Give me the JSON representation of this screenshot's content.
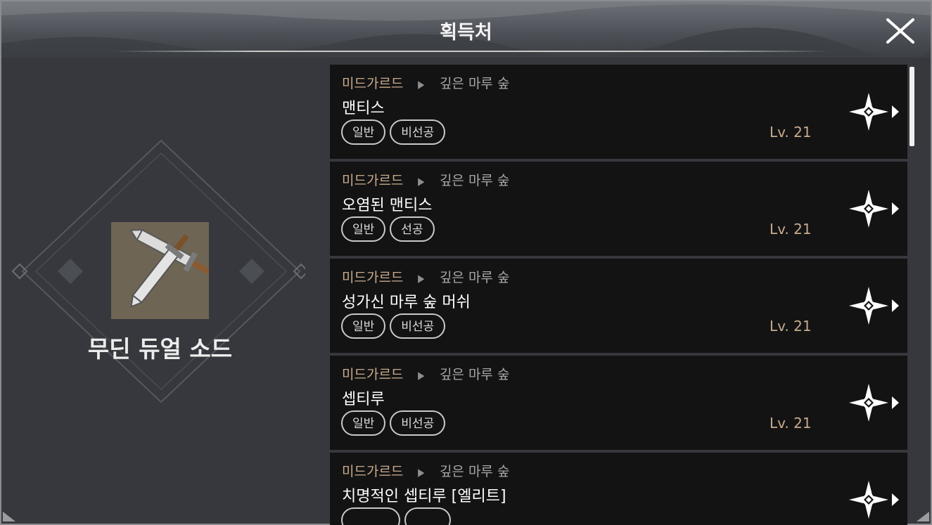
{
  "dialog": {
    "title": "획득처",
    "close_icon": "close-x-icon"
  },
  "item": {
    "name": "무딘 듀얼 소드",
    "icon": "dual-sword-icon",
    "icon_bg": "#6f6555"
  },
  "colors": {
    "region": "#c8ab8b",
    "level": "#c8ab8b",
    "zone": "#a6a6a6"
  },
  "sources": [
    {
      "region": "미드가르드",
      "zone": "깊은 마루 숲",
      "monster": "맨티스",
      "tags": [
        "일반",
        "비선공"
      ],
      "level": "Lv. 21"
    },
    {
      "region": "미드가르드",
      "zone": "깊은 마루 숲",
      "monster": "오염된 맨티스",
      "tags": [
        "일반",
        "선공"
      ],
      "level": "Lv. 21"
    },
    {
      "region": "미드가르드",
      "zone": "깊은 마루 숲",
      "monster": "성가신 마루 숲 머쉬",
      "tags": [
        "일반",
        "비선공"
      ],
      "level": "Lv. 21"
    },
    {
      "region": "미드가르드",
      "zone": "깊은 마루 숲",
      "monster": "셉티루",
      "tags": [
        "일반",
        "비선공"
      ],
      "level": "Lv. 21"
    },
    {
      "region": "미드가르드",
      "zone": "깊은 마루 숲",
      "monster": "치명적인 셉티루 [엘리트]",
      "tags": [
        "",
        ""
      ],
      "level": ""
    }
  ]
}
